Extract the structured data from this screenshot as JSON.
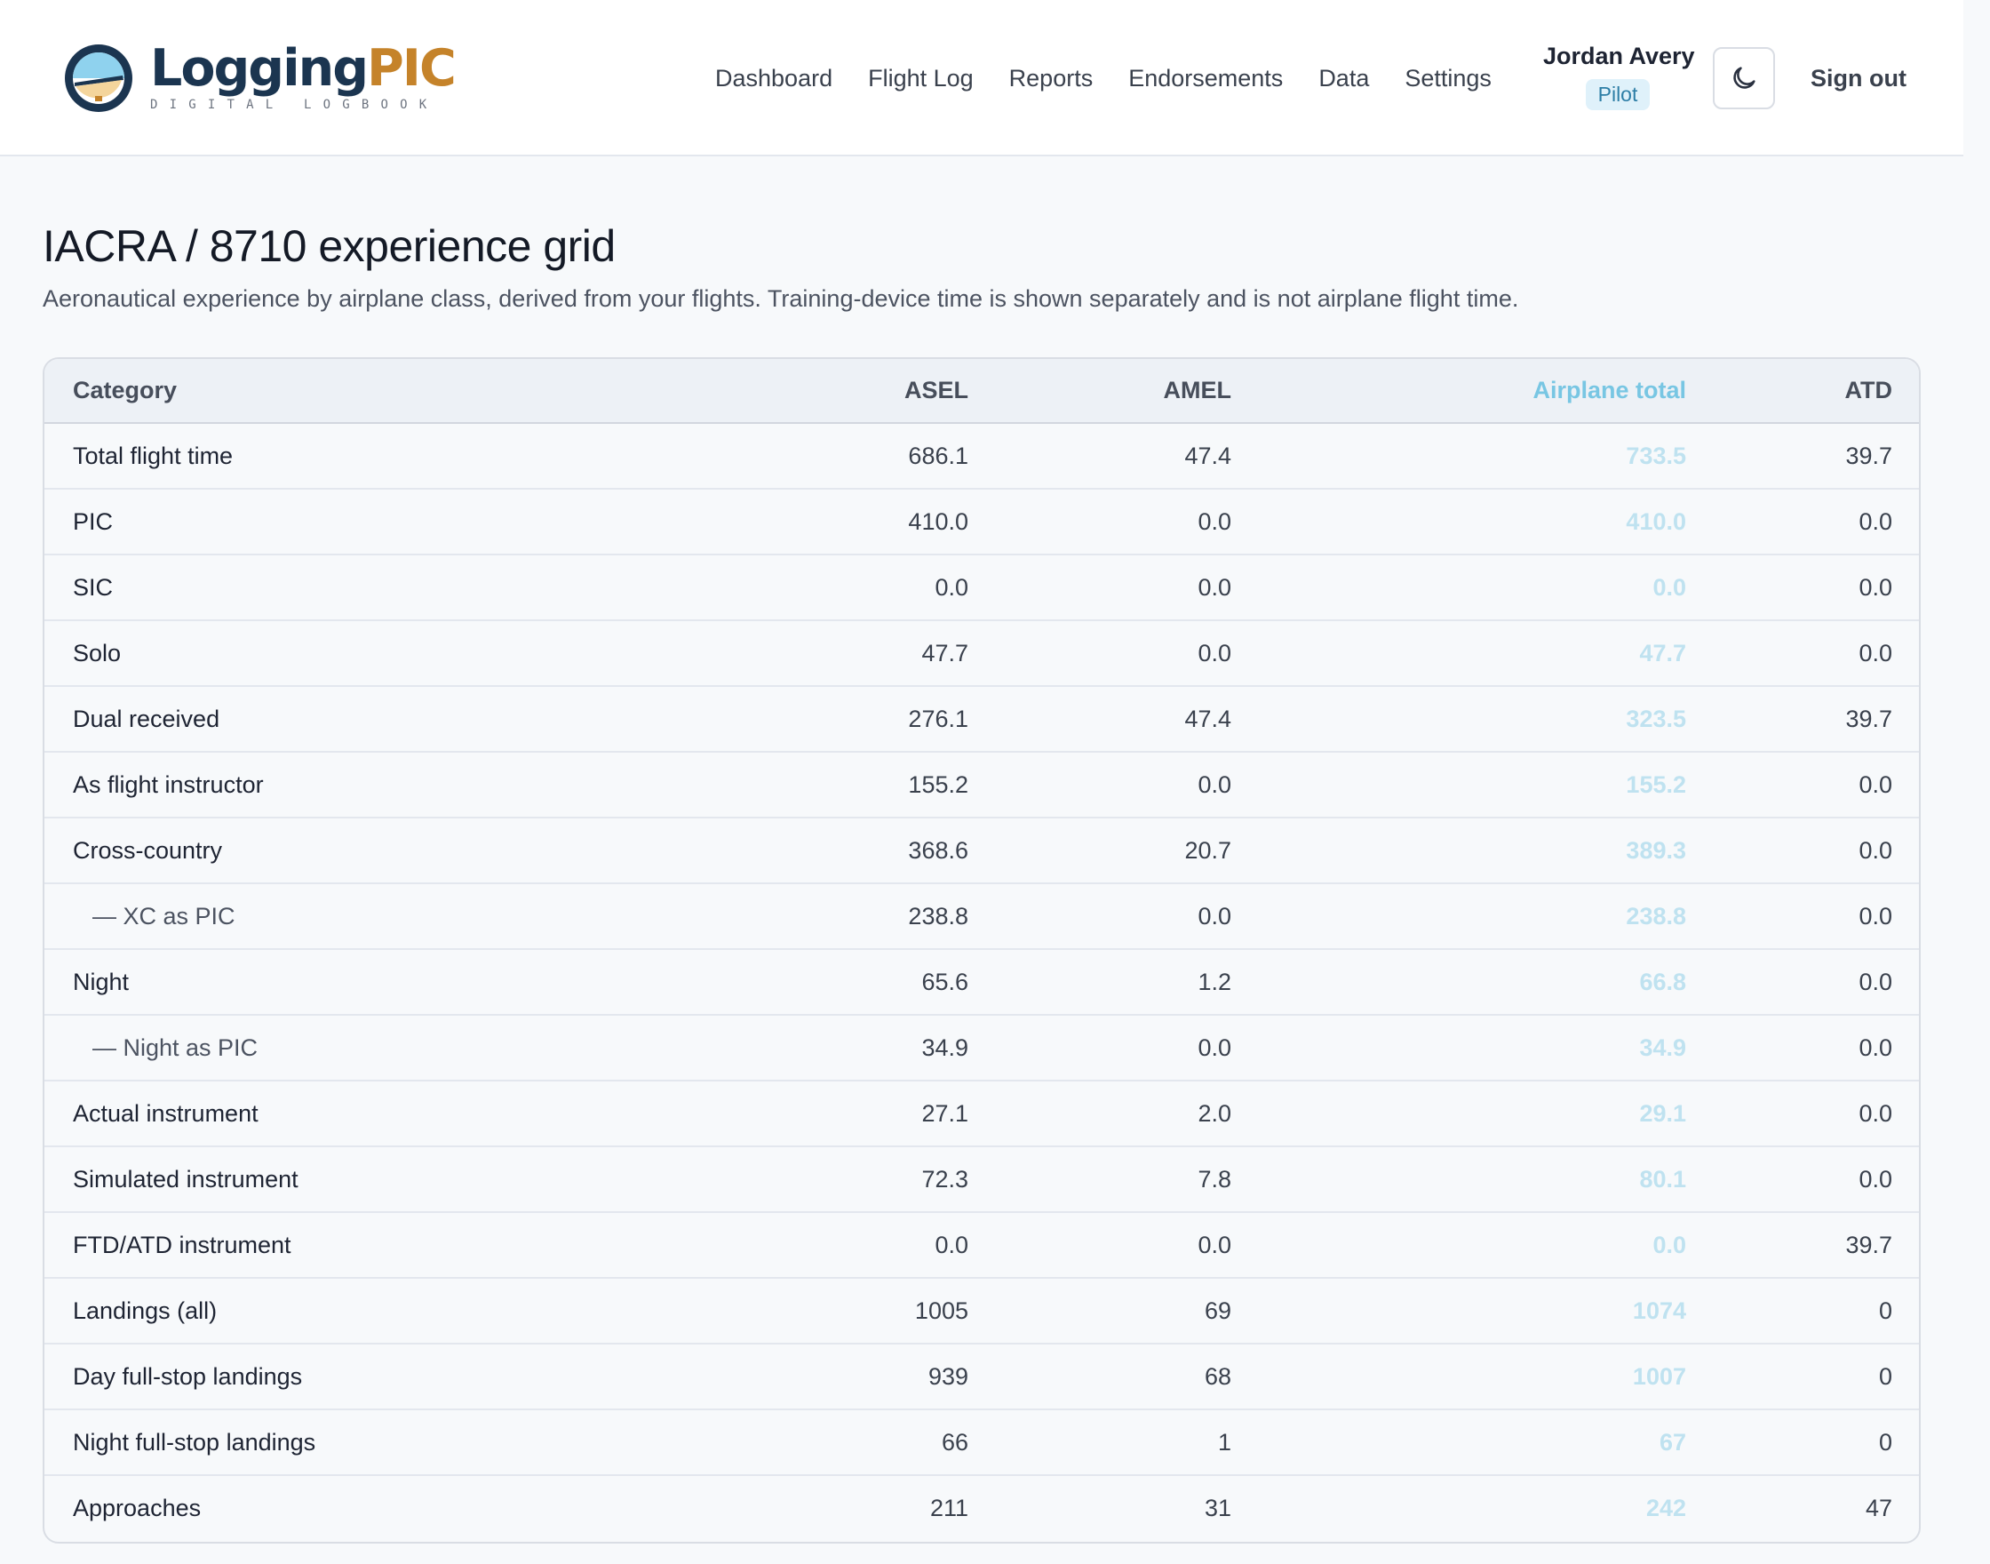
{
  "header": {
    "brand": {
      "name_part1": "Logging",
      "name_part2": "PIC",
      "tagline": "DIGITAL LOGBOOK"
    },
    "nav": [
      "Dashboard",
      "Flight Log",
      "Reports",
      "Endorsements",
      "Data",
      "Settings"
    ],
    "user": {
      "name": "Jordan Avery",
      "role": "Pilot"
    },
    "sign_out": "Sign out",
    "theme_icon": "moon-icon"
  },
  "page": {
    "title": "IACRA / 8710 experience grid",
    "subtitle": "Aeronautical experience by airplane class, derived from your flights. Training-device time is shown separately and is not airplane flight time."
  },
  "grid": {
    "columns": [
      "Category",
      "ASEL",
      "AMEL",
      "Airplane total",
      "ATD"
    ],
    "rows": [
      {
        "label": "Total flight time",
        "asel": "686.1",
        "amel": "47.4",
        "total": "733.5",
        "atd": "39.7",
        "sub": false
      },
      {
        "label": "PIC",
        "asel": "410.0",
        "amel": "0.0",
        "total": "410.0",
        "atd": "0.0",
        "sub": false
      },
      {
        "label": "SIC",
        "asel": "0.0",
        "amel": "0.0",
        "total": "0.0",
        "atd": "0.0",
        "sub": false
      },
      {
        "label": "Solo",
        "asel": "47.7",
        "amel": "0.0",
        "total": "47.7",
        "atd": "0.0",
        "sub": false
      },
      {
        "label": "Dual received",
        "asel": "276.1",
        "amel": "47.4",
        "total": "323.5",
        "atd": "39.7",
        "sub": false
      },
      {
        "label": "As flight instructor",
        "asel": "155.2",
        "amel": "0.0",
        "total": "155.2",
        "atd": "0.0",
        "sub": false
      },
      {
        "label": "Cross-country",
        "asel": "368.6",
        "amel": "20.7",
        "total": "389.3",
        "atd": "0.0",
        "sub": false
      },
      {
        "label": "— XC as PIC",
        "asel": "238.8",
        "amel": "0.0",
        "total": "238.8",
        "atd": "0.0",
        "sub": true
      },
      {
        "label": "Night",
        "asel": "65.6",
        "amel": "1.2",
        "total": "66.8",
        "atd": "0.0",
        "sub": false
      },
      {
        "label": "— Night as PIC",
        "asel": "34.9",
        "amel": "0.0",
        "total": "34.9",
        "atd": "0.0",
        "sub": true
      },
      {
        "label": "Actual instrument",
        "asel": "27.1",
        "amel": "2.0",
        "total": "29.1",
        "atd": "0.0",
        "sub": false
      },
      {
        "label": "Simulated instrument",
        "asel": "72.3",
        "amel": "7.8",
        "total": "80.1",
        "atd": "0.0",
        "sub": false
      },
      {
        "label": "FTD/ATD instrument",
        "asel": "0.0",
        "amel": "0.0",
        "total": "0.0",
        "atd": "39.7",
        "sub": false
      },
      {
        "label": "Landings (all)",
        "asel": "1005",
        "amel": "69",
        "total": "1074",
        "atd": "0",
        "sub": false
      },
      {
        "label": "Day full-stop landings",
        "asel": "939",
        "amel": "68",
        "total": "1007",
        "atd": "0",
        "sub": false
      },
      {
        "label": "Night full-stop landings",
        "asel": "66",
        "amel": "1",
        "total": "67",
        "atd": "0",
        "sub": false
      },
      {
        "label": "Approaches",
        "asel": "211",
        "amel": "31",
        "total": "242",
        "atd": "47",
        "sub": false
      }
    ]
  },
  "colors": {
    "brand_navy": "#1b3550",
    "brand_gold": "#c5832a",
    "accent_total": "#78c6e3",
    "role_badge_bg": "#dff1fa"
  }
}
